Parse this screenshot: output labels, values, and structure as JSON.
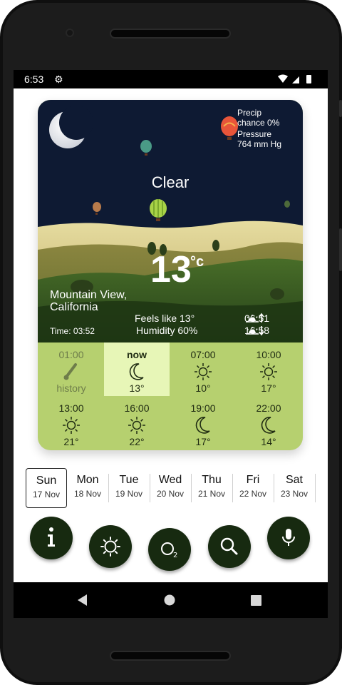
{
  "status": {
    "time": "6:53"
  },
  "weather": {
    "precip_label": "Precip",
    "precip_value": "chance 0%",
    "pressure_label": "Pressure",
    "pressure_value": "764 mm Hg",
    "condition": "Clear",
    "temperature": "13",
    "unit": "°c",
    "location": "Mountain View, California",
    "local_time": "Time: 03:52",
    "feels_like": "Feels like 13°",
    "humidity": "Humidity 60%",
    "sunrise": "06:51",
    "sunset": "16:58"
  },
  "hourly": [
    {
      "time": "01:00",
      "icon": "thermometer-icon",
      "value": "history"
    },
    {
      "time": "now",
      "icon": "moon-icon",
      "value": "13°"
    },
    {
      "time": "07:00",
      "icon": "sun-icon",
      "value": "10°"
    },
    {
      "time": "10:00",
      "icon": "sun-icon",
      "value": "17°"
    },
    {
      "time": "13:00",
      "icon": "sun-icon",
      "value": "21°"
    },
    {
      "time": "16:00",
      "icon": "sun-icon",
      "value": "22°"
    },
    {
      "time": "19:00",
      "icon": "moon-icon",
      "value": "17°"
    },
    {
      "time": "22:00",
      "icon": "moon-icon",
      "value": "14°"
    }
  ],
  "days": [
    {
      "name": "Sun",
      "date": "17 Nov",
      "selected": true
    },
    {
      "name": "Mon",
      "date": "18 Nov"
    },
    {
      "name": "Tue",
      "date": "19 Nov"
    },
    {
      "name": "Wed",
      "date": "20 Nov"
    },
    {
      "name": "Thu",
      "date": "21 Nov"
    },
    {
      "name": "Fri",
      "date": "22 Nov"
    },
    {
      "name": "Sat",
      "date": "23 Nov"
    }
  ],
  "actions": [
    {
      "icon": "info-icon"
    },
    {
      "icon": "sun-settings-icon"
    },
    {
      "icon": "o2-icon",
      "label": "O",
      "sub": "2"
    },
    {
      "icon": "search-icon"
    },
    {
      "icon": "microphone-icon"
    }
  ],
  "colors": {
    "sky": "#0e1a33",
    "card_green": "#b6d06f",
    "now_highlight": "#e7f6b7",
    "button_dark": "#172a10"
  }
}
